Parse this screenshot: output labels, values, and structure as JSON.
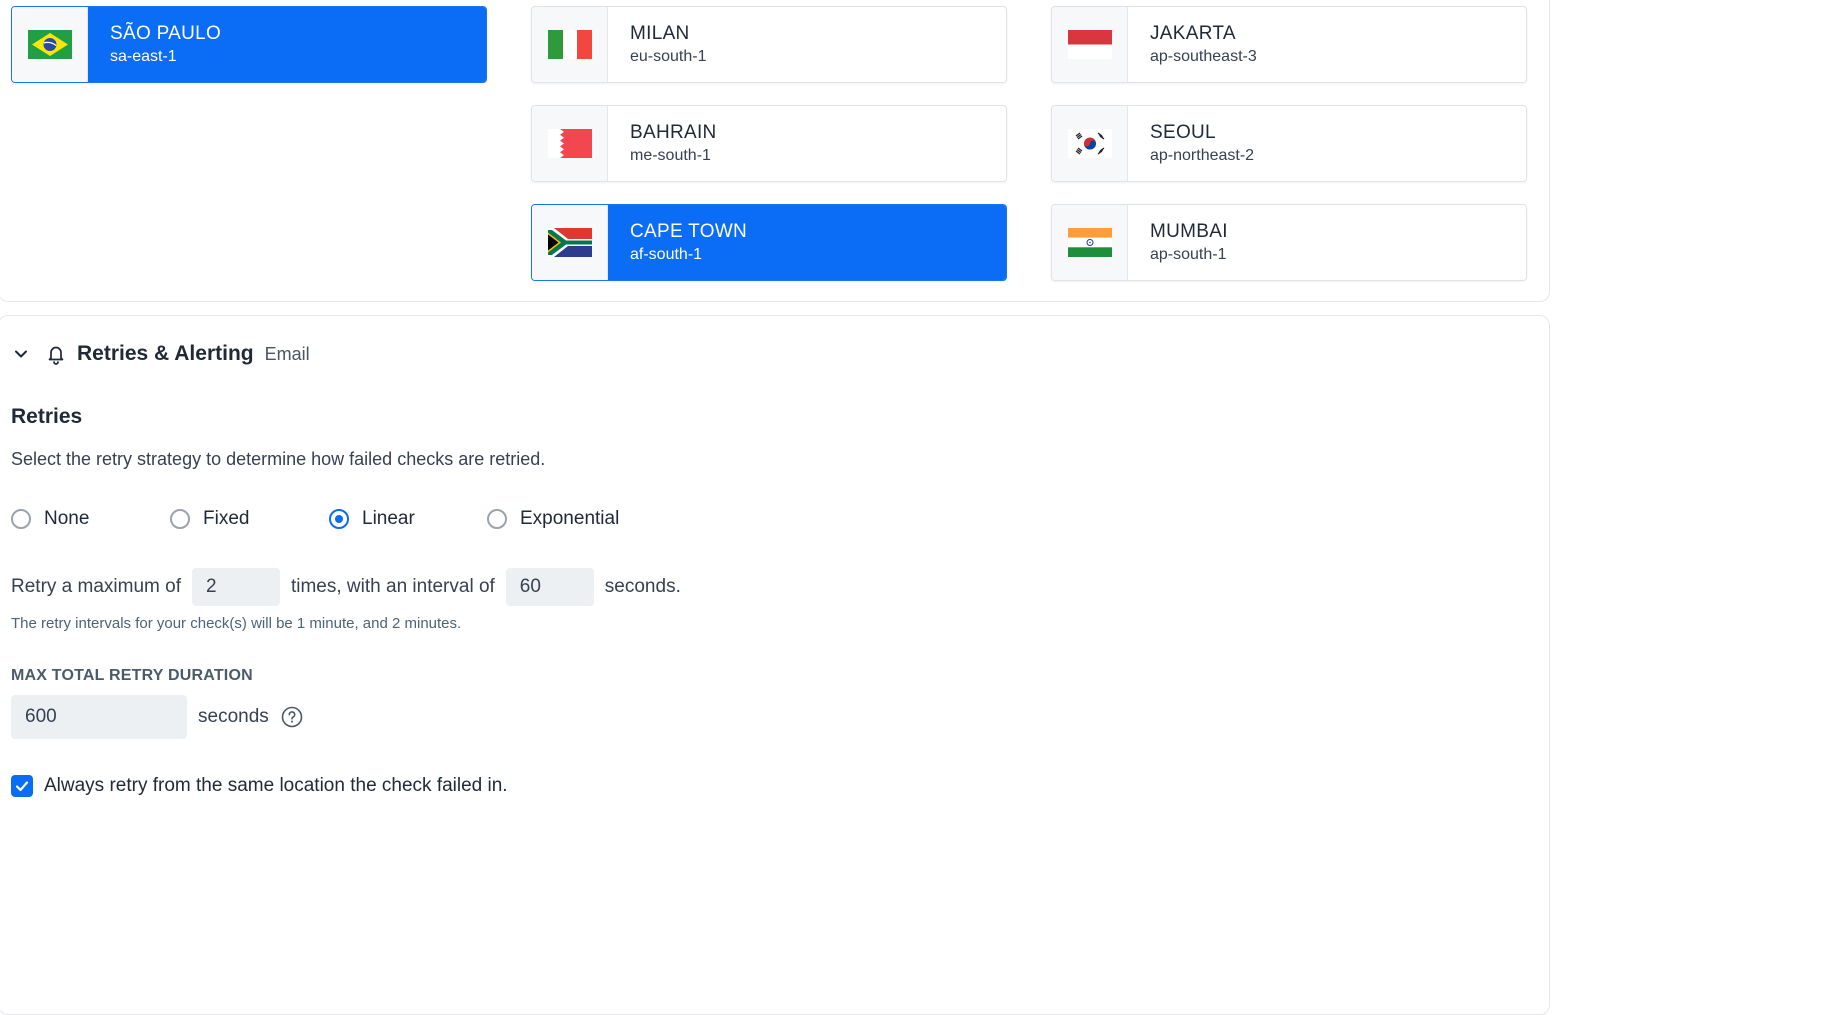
{
  "locations": [
    {
      "city": "SÃO PAULO",
      "code": "sa-east-1",
      "flag": "brazil-flag",
      "selected": true
    },
    {
      "city": "MILAN",
      "code": "eu-south-1",
      "flag": "italy-flag",
      "selected": false
    },
    {
      "city": "JAKARTA",
      "code": "ap-southeast-3",
      "flag": "indonesia-flag",
      "selected": false
    },
    {
      "city": "BAHRAIN",
      "code": "me-south-1",
      "flag": "bahrain-flag",
      "selected": false
    },
    {
      "city": "SEOUL",
      "code": "ap-northeast-2",
      "flag": "south-korea-flag",
      "selected": false
    },
    {
      "city": "CAPE TOWN",
      "code": "af-south-1",
      "flag": "south-africa-flag",
      "selected": true
    },
    {
      "city": "MUMBAI",
      "code": "ap-south-1",
      "flag": "india-flag",
      "selected": false
    }
  ],
  "alerting": {
    "title": "Retries & Alerting",
    "subtitle": "Email",
    "expanded": true
  },
  "retries": {
    "heading": "Retries",
    "description": "Select the retry strategy to determine how failed checks are retried.",
    "strategies": [
      {
        "label": "None",
        "checked": false
      },
      {
        "label": "Fixed",
        "checked": false
      },
      {
        "label": "Linear",
        "checked": true
      },
      {
        "label": "Exponential",
        "checked": false
      }
    ],
    "line_prefix": "Retry a maximum of",
    "max_retries": "2",
    "line_middle": "times, with an interval of",
    "interval": "60",
    "line_suffix": "seconds.",
    "hint": "The retry intervals for your check(s) will be 1 minute, and 2 minutes.",
    "max_duration_label": "MAX TOTAL RETRY DURATION",
    "max_duration": "600",
    "max_duration_unit": "seconds",
    "same_location_label": "Always retry from the same location the check failed in.",
    "same_location_checked": true
  },
  "colors": {
    "accent": "#0b6cf5",
    "card_border": "#dfe3e8",
    "input_bg": "#edf0f3"
  }
}
